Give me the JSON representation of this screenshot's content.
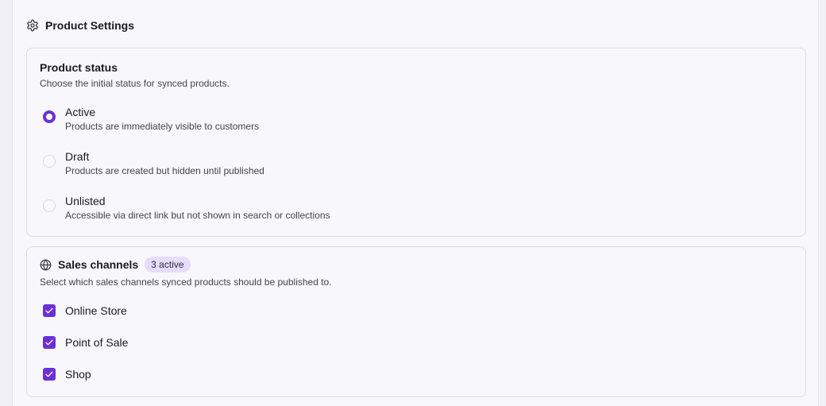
{
  "header": {
    "title": "Product Settings",
    "icon": "gear-icon"
  },
  "product_status": {
    "title": "Product status",
    "description": "Choose the initial status for synced products.",
    "selected": "Active",
    "options": [
      {
        "label": "Active",
        "description": "Products are immediately visible to customers",
        "checked": true
      },
      {
        "label": "Draft",
        "description": "Products are created but hidden until published",
        "checked": false
      },
      {
        "label": "Unlisted",
        "description": "Accessible via direct link but not shown in search or collections",
        "checked": false
      }
    ]
  },
  "sales_channels": {
    "title": "Sales channels",
    "icon": "globe-icon",
    "badge": "3 active",
    "description": "Select which sales channels synced products should be published to.",
    "channels": [
      {
        "label": "Online Store",
        "checked": true
      },
      {
        "label": "Point of Sale",
        "checked": true
      },
      {
        "label": "Shop",
        "checked": true
      }
    ]
  },
  "colors": {
    "accent": "#6b2fd6",
    "badge_bg": "#e5defa",
    "background": "#f8f7fc",
    "border": "#dddae6"
  }
}
